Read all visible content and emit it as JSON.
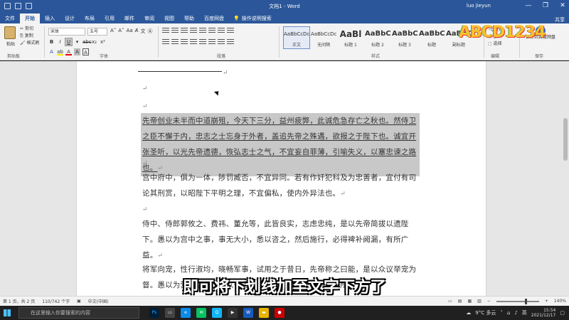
{
  "titlebar": {
    "doc_title": "文档1 - Word",
    "user": "luo jieyun",
    "minimize": "—",
    "restore": "❐",
    "close": "✕"
  },
  "tabs": [
    "文件",
    "开始",
    "插入",
    "设计",
    "布局",
    "引用",
    "邮件",
    "审阅",
    "视图",
    "帮助",
    "百度网盘"
  ],
  "active_tab": "开始",
  "tell_me": "操作说明搜索",
  "share": "共享",
  "ribbon": {
    "clipboard": {
      "paste": "粘贴",
      "cut": "剪切",
      "copy": "复制",
      "format_painter": "格式刷",
      "label": "剪贴板"
    },
    "font": {
      "font_name": "宋体",
      "font_size": "五号",
      "label": "字体"
    },
    "paragraph": {
      "label": "段落"
    },
    "styles": {
      "label": "样式",
      "items": [
        {
          "sample": "AaBbCcDc",
          "name": "正文"
        },
        {
          "sample": "AaBbCcDc",
          "name": "无间隔"
        },
        {
          "sample": "AaBl",
          "name": "标题 1"
        },
        {
          "sample": "AaBbC",
          "name": "标题 2"
        },
        {
          "sample": "AaBbC",
          "name": "标题 3"
        },
        {
          "sample": "AaBbC",
          "name": "标题"
        },
        {
          "sample": "AaBbC",
          "name": "副标题"
        }
      ]
    },
    "editing": {
      "find": "查找",
      "replace": "替换",
      "select": "选择",
      "label": "编辑"
    },
    "save": {
      "button": "保存到百度网盘",
      "label": "保存"
    }
  },
  "watermark_logo": "ABCD1234",
  "document": {
    "mark": "↵",
    "paragraphs": [
      {
        "text": "先帝创业未半而中道崩殂，今天下三分，益州疲弊，此诚危急存亡之秋也。然侍卫之臣不懈于内，忠志之士忘身于外者，盖追先帝之殊遇，欲报之于陛下也。诚宜开张圣听，以光先帝遗德，恢弘志士之气，不宜妄自菲薄，引喻失义，以塞忠谏之路也。"
      },
      {
        "text": "宫中府中，俱为一体，陟罚臧否，不宜异同。若有作奸犯科及为忠善者，宜付有司论其刑赏，以昭陛下平明之理，不宜偏私，使内外异法也。"
      },
      {
        "text": "侍中、侍郎郭攸之、费祎、董允等，此皆良实，志虑忠纯，是以先帝简拔以遗陛下。愚以为宫中之事，事无大小，悉以咨之，然后施行，必得裨补阙漏，有所广益。"
      },
      {
        "text": "将军向宠，性行淑均，晓畅军事，试用之于昔日，先帝称之曰能，是以众议举宠为督。愚以为营中之事，悉以咨之，必能使行阵和睦，优劣得所。"
      }
    ]
  },
  "subtitle": "即可将下划线加至文字下方了",
  "statusbar": {
    "page": "第 1 页，共 2 页",
    "words": "110/742 个字",
    "language": "中文(中国)",
    "zoom": "140%"
  },
  "taskbar": {
    "search_placeholder": "在这里输入你要搜索的内容",
    "weather": "9°C 多云",
    "ime": "英",
    "time": "15:54",
    "date": "2021/12/17"
  }
}
